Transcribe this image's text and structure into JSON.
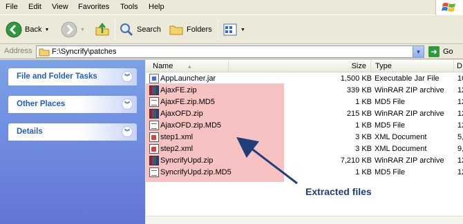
{
  "menu": [
    "File",
    "Edit",
    "View",
    "Favorites",
    "Tools",
    "Help"
  ],
  "toolbar": {
    "back_label": "Back",
    "search_label": "Search",
    "folders_label": "Folders"
  },
  "address": {
    "label": "Address",
    "path": "F:\\Syncrify\\patches",
    "go_label": "Go"
  },
  "tasks": [
    {
      "title": "File and Folder Tasks"
    },
    {
      "title": "Other Places"
    },
    {
      "title": "Details"
    }
  ],
  "columns": {
    "name": "Name",
    "size": "Size",
    "type": "Type",
    "date": "D"
  },
  "files": [
    {
      "name": "AppLauncher.jar",
      "size": "1,500 KB",
      "type": "Executable Jar File",
      "date": "10",
      "icon": "jar-icon"
    },
    {
      "name": "AjaxFE.zip",
      "size": "339 KB",
      "type": "WinRAR ZIP archive",
      "date": "12",
      "icon": "winrar-icon"
    },
    {
      "name": "AjaxFE.zip.MD5",
      "size": "1 KB",
      "type": "MD5 File",
      "date": "12",
      "icon": "md5-file-icon"
    },
    {
      "name": "AjaxOFD.zip",
      "size": "215 KB",
      "type": "WinRAR ZIP archive",
      "date": "12",
      "icon": "winrar-icon"
    },
    {
      "name": "AjaxOFD.zip.MD5",
      "size": "1 KB",
      "type": "MD5 File",
      "date": "12",
      "icon": "md5-file-icon"
    },
    {
      "name": "step1.xml",
      "size": "3 KB",
      "type": "XML Document",
      "date": "5,",
      "icon": "xml-file-icon"
    },
    {
      "name": "step2.xml",
      "size": "3 KB",
      "type": "XML Document",
      "date": "9,",
      "icon": "xml-file-icon"
    },
    {
      "name": "SyncrifyUpd.zip",
      "size": "7,210 KB",
      "type": "WinRAR ZIP archive",
      "date": "12",
      "icon": "winrar-icon"
    },
    {
      "name": "SyncrifyUpd.zip.MD5",
      "size": "1 KB",
      "type": "MD5 File",
      "date": "12",
      "icon": "md5-file-icon"
    }
  ],
  "annotation": {
    "label": "Extracted files",
    "color": "#1f3e7a",
    "highlight_color": "#f6c2c2"
  }
}
